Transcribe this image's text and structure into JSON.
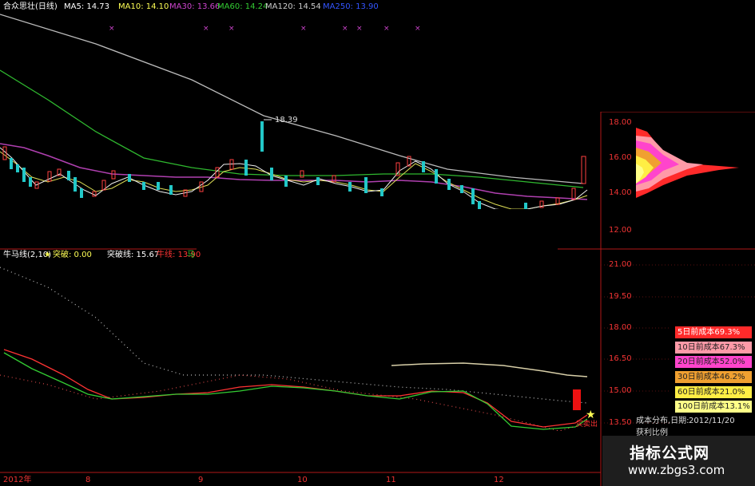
{
  "top_legend": {
    "name": "合众思壮(日线)",
    "items": [
      {
        "label": "MA5: 14.73",
        "color": "#ffffff"
      },
      {
        "label": "MA10: 14.10",
        "color": "#ffff55"
      },
      {
        "label": "MA30: 13.66",
        "color": "#cc44cc"
      },
      {
        "label": "MA60: 14.24",
        "color": "#33cc33"
      },
      {
        "label": "MA120: 14.54",
        "color": "#cccccc"
      },
      {
        "label": "MA250: 13.90",
        "color": "#3355ff"
      }
    ]
  },
  "bottom_legend": {
    "name": "牛马线(2,10)",
    "items": [
      {
        "label": "突破: 0.00",
        "color": "#ffff55"
      },
      {
        "label": "突破线: 15.67",
        "color": "#ffffff"
      },
      {
        "label": "牛线: 13.90",
        "color": "#ff3333"
      },
      {
        "label": "马",
        "color": "#33cc33"
      }
    ]
  },
  "peak_label": "18.39",
  "upper_axis": [
    "18.00",
    "16.00",
    "14.00",
    "12.00"
  ],
  "lower_axis": [
    "21.00",
    "19.50",
    "18.00",
    "16.50",
    "15.00",
    "13.50"
  ],
  "x_axis": [
    "2012年",
    "8",
    "9",
    "10",
    "11",
    "12"
  ],
  "cost_distribution": [
    {
      "label": "5日前成本69.3%",
      "color": "#ff2a2a"
    },
    {
      "label": "10日前成本67.3%",
      "color": "#ff9aa8"
    },
    {
      "label": "20日前成本52.0%",
      "color": "#ff44cc"
    },
    {
      "label": "30日前成本46.2%",
      "color": "#f0a030"
    },
    {
      "label": "60日前成本21.0%",
      "color": "#ffee44"
    },
    {
      "label": "100日前成本13.1%",
      "color": "#ffff88"
    }
  ],
  "cost_footer": {
    "label": "成本分布,日期:",
    "date": "2012/11/20",
    "sub": "获利比例"
  },
  "signal_label": "买卖出",
  "watermark": {
    "title": "指标公式网",
    "url": "www.zbgs3.com"
  }
}
